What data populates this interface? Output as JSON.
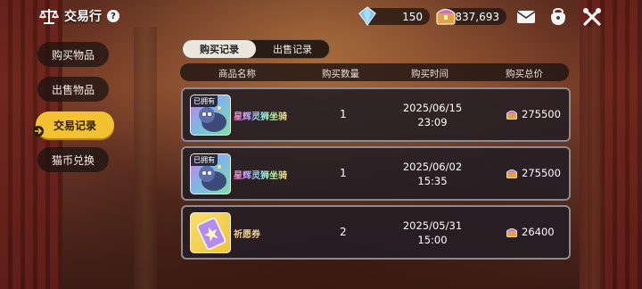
{
  "header": {
    "title": "交易行",
    "help_glyph": "?",
    "currency_gems": "150",
    "currency_coins": "837,693"
  },
  "sidebar": {
    "items": [
      {
        "label": "购买物品",
        "active": false
      },
      {
        "label": "出售物品",
        "active": false
      },
      {
        "label": "交易记录",
        "active": true
      },
      {
        "label": "猫币兑换",
        "active": false
      }
    ]
  },
  "tabs": [
    {
      "label": "购买记录",
      "active": true
    },
    {
      "label": "出售记录",
      "active": false
    }
  ],
  "columns": [
    "商品名称",
    "购买数量",
    "购买时间",
    "购买总价"
  ],
  "rows": [
    {
      "owned_badge": "已拥有",
      "name": "星辉灵狮坐骑",
      "qty": "1",
      "date": "2025/06/15",
      "time": "23:09",
      "total": "275500",
      "icon": "lion-mount-icon"
    },
    {
      "owned_badge": "已拥有",
      "name": "星辉灵狮坐骑",
      "qty": "1",
      "date": "2025/06/02",
      "time": "15:35",
      "total": "275500",
      "icon": "lion-mount-icon"
    },
    {
      "owned_badge": "",
      "name": "祈愿券",
      "qty": "2",
      "date": "2025/05/31",
      "time": "15:00",
      "total": "26400",
      "icon": "wish-ticket-icon"
    }
  ],
  "colors": {
    "accent": "#f3c233",
    "panel": "#231e24",
    "row_border": "#8e8a8e"
  }
}
